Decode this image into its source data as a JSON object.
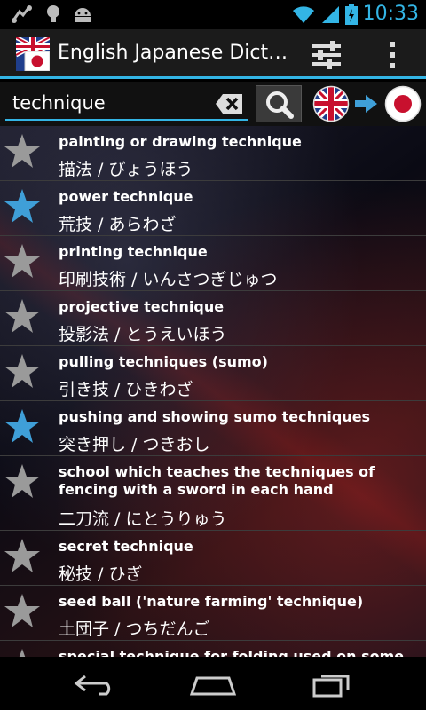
{
  "status_bar": {
    "time": "10:33",
    "icons": [
      "usb-debug-icon",
      "lightbulb-icon",
      "android-icon",
      "wifi-icon",
      "signal-icon",
      "battery-charging-icon"
    ]
  },
  "action_bar": {
    "title": "English Japanese Dict…",
    "icons": [
      "uk-japan-flag-app-icon",
      "settings-sliders-icon",
      "overflow-menu-icon"
    ]
  },
  "search": {
    "value": "technique",
    "clear_icon": "backspace-clear-icon",
    "search_icon": "search-icon",
    "direction": {
      "from": "uk-flag-icon",
      "arrow": "arrow-right-icon",
      "to": "japan-flag-icon"
    }
  },
  "colors": {
    "accent": "#33b5e5",
    "star_on": "#3f9fd8",
    "star_off": "#9a9a9a"
  },
  "results": [
    {
      "en": "painting or drawing technique",
      "jp": "描法 / びょうほう",
      "starred": false
    },
    {
      "en": "power technique",
      "jp": "荒技 / あらわざ",
      "starred": true
    },
    {
      "en": "printing technique",
      "jp": "印刷技術 / いんさつぎじゅつ",
      "starred": false
    },
    {
      "en": "projective technique",
      "jp": "投影法 / とうえいほう",
      "starred": false
    },
    {
      "en": "pulling techniques (sumo)",
      "jp": "引き技 / ひきわざ",
      "starred": false
    },
    {
      "en": "pushing and showing sumo techniques",
      "jp": "突き押し / つきおし",
      "starred": true
    },
    {
      "en": "school which teaches the techniques of fencing with a sword in each hand",
      "jp": "二刀流 / にとうりゅう",
      "starred": false
    },
    {
      "en": "secret technique",
      "jp": "秘技 / ひぎ",
      "starred": false
    },
    {
      "en": "seed ball ('nature farming' technique)",
      "jp": "土団子 / つちだんご",
      "starred": false
    },
    {
      "en": "special technique for folding used on some solar",
      "jp": "",
      "starred": false
    }
  ],
  "nav_bar": {
    "icons": [
      "back-icon",
      "home-icon",
      "recent-apps-icon"
    ]
  }
}
